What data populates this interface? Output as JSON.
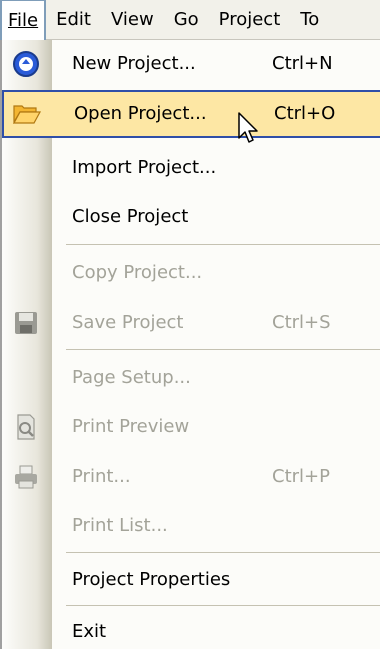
{
  "menubar": {
    "items": [
      {
        "label": "File",
        "underline": "F"
      },
      {
        "label": "Edit",
        "underline": "E"
      },
      {
        "label": "View",
        "underline": "V"
      },
      {
        "label": "Go",
        "underline": "G"
      },
      {
        "label": "Project",
        "underline": "P"
      },
      {
        "label": "Too",
        "underline": "T"
      }
    ]
  },
  "menu": {
    "items": [
      {
        "label": "New Project...",
        "shortcut": "Ctrl+N",
        "icon": "new-project-icon",
        "enabled": true
      },
      {
        "label": "Open Project...",
        "shortcut": "Ctrl+O",
        "icon": "open-folder-icon",
        "enabled": true,
        "highlighted": true
      },
      {
        "label": "Import Project...",
        "shortcut": "",
        "enabled": true
      },
      {
        "label": "Close Project",
        "shortcut": "",
        "enabled": true
      },
      {
        "label": "Copy Project...",
        "shortcut": "",
        "enabled": false
      },
      {
        "label": "Save Project",
        "shortcut": "Ctrl+S",
        "icon": "save-icon",
        "enabled": false
      },
      {
        "label": "Page Setup...",
        "shortcut": "",
        "enabled": false
      },
      {
        "label": "Print Preview",
        "shortcut": "",
        "icon": "print-preview-icon",
        "enabled": false
      },
      {
        "label": "Print...",
        "shortcut": "Ctrl+P",
        "icon": "printer-icon",
        "enabled": false
      },
      {
        "label": "Print List...",
        "shortcut": "",
        "enabled": false
      },
      {
        "label": "Project Properties",
        "shortcut": "",
        "enabled": true
      },
      {
        "label": "Exit",
        "shortcut": "",
        "enabled": true
      }
    ]
  },
  "colors": {
    "highlight_bg": "#fde7a4",
    "highlight_border": "#2f4fa8",
    "disabled_text": "#a3a399"
  }
}
